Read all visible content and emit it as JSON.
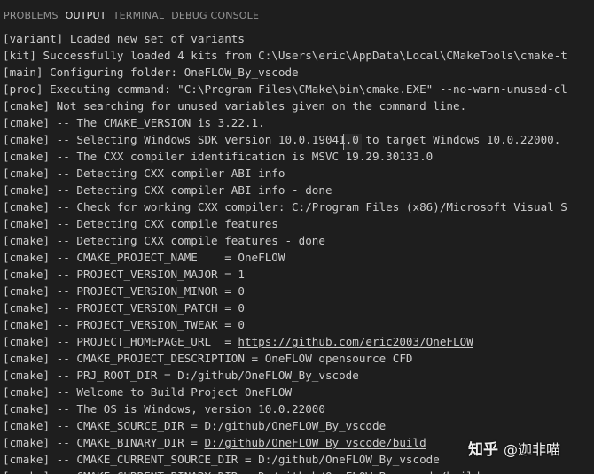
{
  "tabs": [
    {
      "label": "PROBLEMS",
      "active": false
    },
    {
      "label": "OUTPUT",
      "active": true
    },
    {
      "label": "TERMINAL",
      "active": false
    },
    {
      "label": "DEBUG CONSOLE",
      "active": false
    }
  ],
  "output": {
    "lines": [
      {
        "text": "[variant] Loaded new set of variants"
      },
      {
        "text": "[kit] Successfully loaded 4 kits from C:\\Users\\eric\\AppData\\Local\\CMakeTools\\cmake-t"
      },
      {
        "text": "[main] Configuring folder: OneFLOW_By_vscode"
      },
      {
        "text": "[proc] Executing command: \"C:\\Program Files\\CMake\\bin\\cmake.EXE\" --no-warn-unused-cl"
      },
      {
        "text": "[cmake] Not searching for unused variables given on the command line."
      },
      {
        "text": "[cmake] -- The CMAKE_VERSION is 3.22.1."
      },
      {
        "text": "[cmake] -- Selecting Windows SDK version 10.0.19041.0 to target Windows 10.0.22000."
      },
      {
        "text": "[cmake] -- The CXX compiler identification is MSVC 19.29.30133.0"
      },
      {
        "text": "[cmake] -- Detecting CXX compiler ABI info"
      },
      {
        "text": "[cmake] -- Detecting CXX compiler ABI info - done"
      },
      {
        "text": "[cmake] -- Check for working CXX compiler: C:/Program Files (x86)/Microsoft Visual S"
      },
      {
        "text": "[cmake] -- Detecting CXX compile features"
      },
      {
        "text": "[cmake] -- Detecting CXX compile features - done"
      },
      {
        "text": "[cmake] -- CMAKE_PROJECT_NAME    = OneFLOW"
      },
      {
        "text": "[cmake] -- PROJECT_VERSION_MAJOR = 1"
      },
      {
        "text": "[cmake] -- PROJECT_VERSION_MINOR = 0"
      },
      {
        "text": "[cmake] -- PROJECT_VERSION_PATCH = 0"
      },
      {
        "text": "[cmake] -- PROJECT_VERSION_TWEAK = 0"
      },
      {
        "text": "[cmake] -- PROJECT_HOMEPAGE_URL  = ",
        "link": "https://github.com/eric2003/OneFLOW"
      },
      {
        "text": "[cmake] -- CMAKE_PROJECT_DESCRIPTION = OneFLOW opensource CFD"
      },
      {
        "text": "[cmake] -- PRJ_ROOT_DIR = D:/github/OneFLOW_By_vscode"
      },
      {
        "text": "[cmake] -- Welcome to Build Project OneFLOW"
      },
      {
        "text": "[cmake] -- The OS is Windows, version 10.0.22000"
      },
      {
        "text": "[cmake] -- CMAKE_SOURCE_DIR = D:/github/OneFLOW_By_vscode"
      },
      {
        "text": "[cmake] -- CMAKE_BINARY_DIR = ",
        "link": "D:/github/OneFLOW_By_vscode/build"
      },
      {
        "text": "[cmake] -- CMAKE_CURRENT_SOURCE_DIR = D:/github/OneFLOW_By_vscode"
      },
      {
        "text": "[cmake] -- CMAKE_CURRENT_BINARY_DIR = D:/github/OneFLOW_By_vscode/build"
      }
    ]
  },
  "watermark": {
    "logo": "知乎",
    "author": "@迦非喵"
  },
  "colors": {
    "background": "#1e1e1e",
    "text": "#cccccc",
    "tab_inactive": "#969696",
    "tab_active": "#e7e7e7"
  }
}
